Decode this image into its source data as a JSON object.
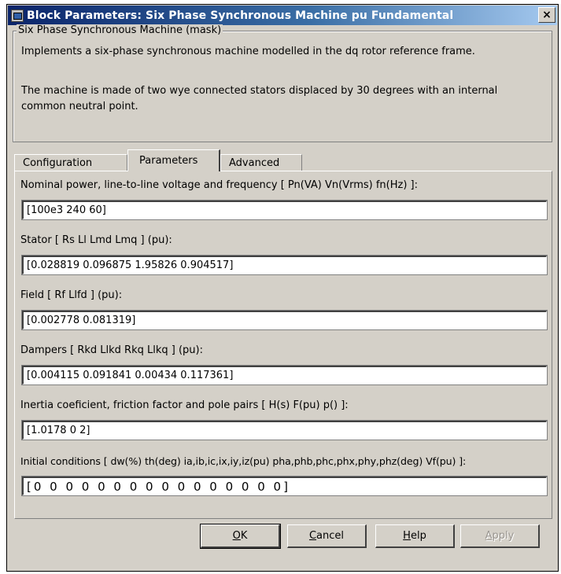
{
  "window": {
    "title": "Block Parameters: Six Phase Synchronous Machine pu Fundamental",
    "close_label": "×"
  },
  "mask": {
    "legend": "Six Phase Synchronous Machine (mask)",
    "description_1": "Implements a six-phase synchronous machine modelled in the dq rotor reference frame.",
    "description_2": "The machine is made of two wye connected stators displaced by 30 degrees with an internal common neutral point."
  },
  "tabs": [
    {
      "label": "Configuration",
      "active": false
    },
    {
      "label": "Parameters",
      "active": true
    },
    {
      "label": "Advanced",
      "active": false
    }
  ],
  "parameters": [
    {
      "label": "Nominal power, line-to-line voltage and frequency [ Pn(VA)  Vn(Vrms)  fn(Hz) ]:",
      "value": "[100e3 240 60]"
    },
    {
      "label": "Stator  [ Rs  Ll  Lmd  Lmq ] (pu):",
      "value": "[0.028819 0.096875 1.95826 0.904517]"
    },
    {
      "label": "Field  [ Rf  Llfd ] (pu):",
      "value": "[0.002778 0.081319]"
    },
    {
      "label": "Dampers  [ Rkd  Llkd  Rkq  Llkq ] (pu):",
      "value": "[0.004115 0.091841 0.00434 0.117361]"
    },
    {
      "label": "Inertia coeficient, friction factor and pole pairs [ H(s)  F(pu)  p() ]:",
      "value": "[1.0178 0 2]"
    },
    {
      "label": "Initial conditions [ dw(%)  th(deg)  ia,ib,ic,ix,iy,iz(pu)  pha,phb,phc,phx,phy,phz(deg)  Vf(pu) ]:",
      "value": "[0 0 0 0 0 0 0 0 0 0 0 0 0 0 0 0]"
    }
  ],
  "buttons": {
    "ok": {
      "mnemonic": "O",
      "rest": "K"
    },
    "cancel": {
      "mnemonic": "C",
      "rest": "ancel"
    },
    "help": {
      "mnemonic": "H",
      "rest": "elp"
    },
    "apply": {
      "mnemonic": "A",
      "rest": "pply",
      "enabled": false
    }
  }
}
